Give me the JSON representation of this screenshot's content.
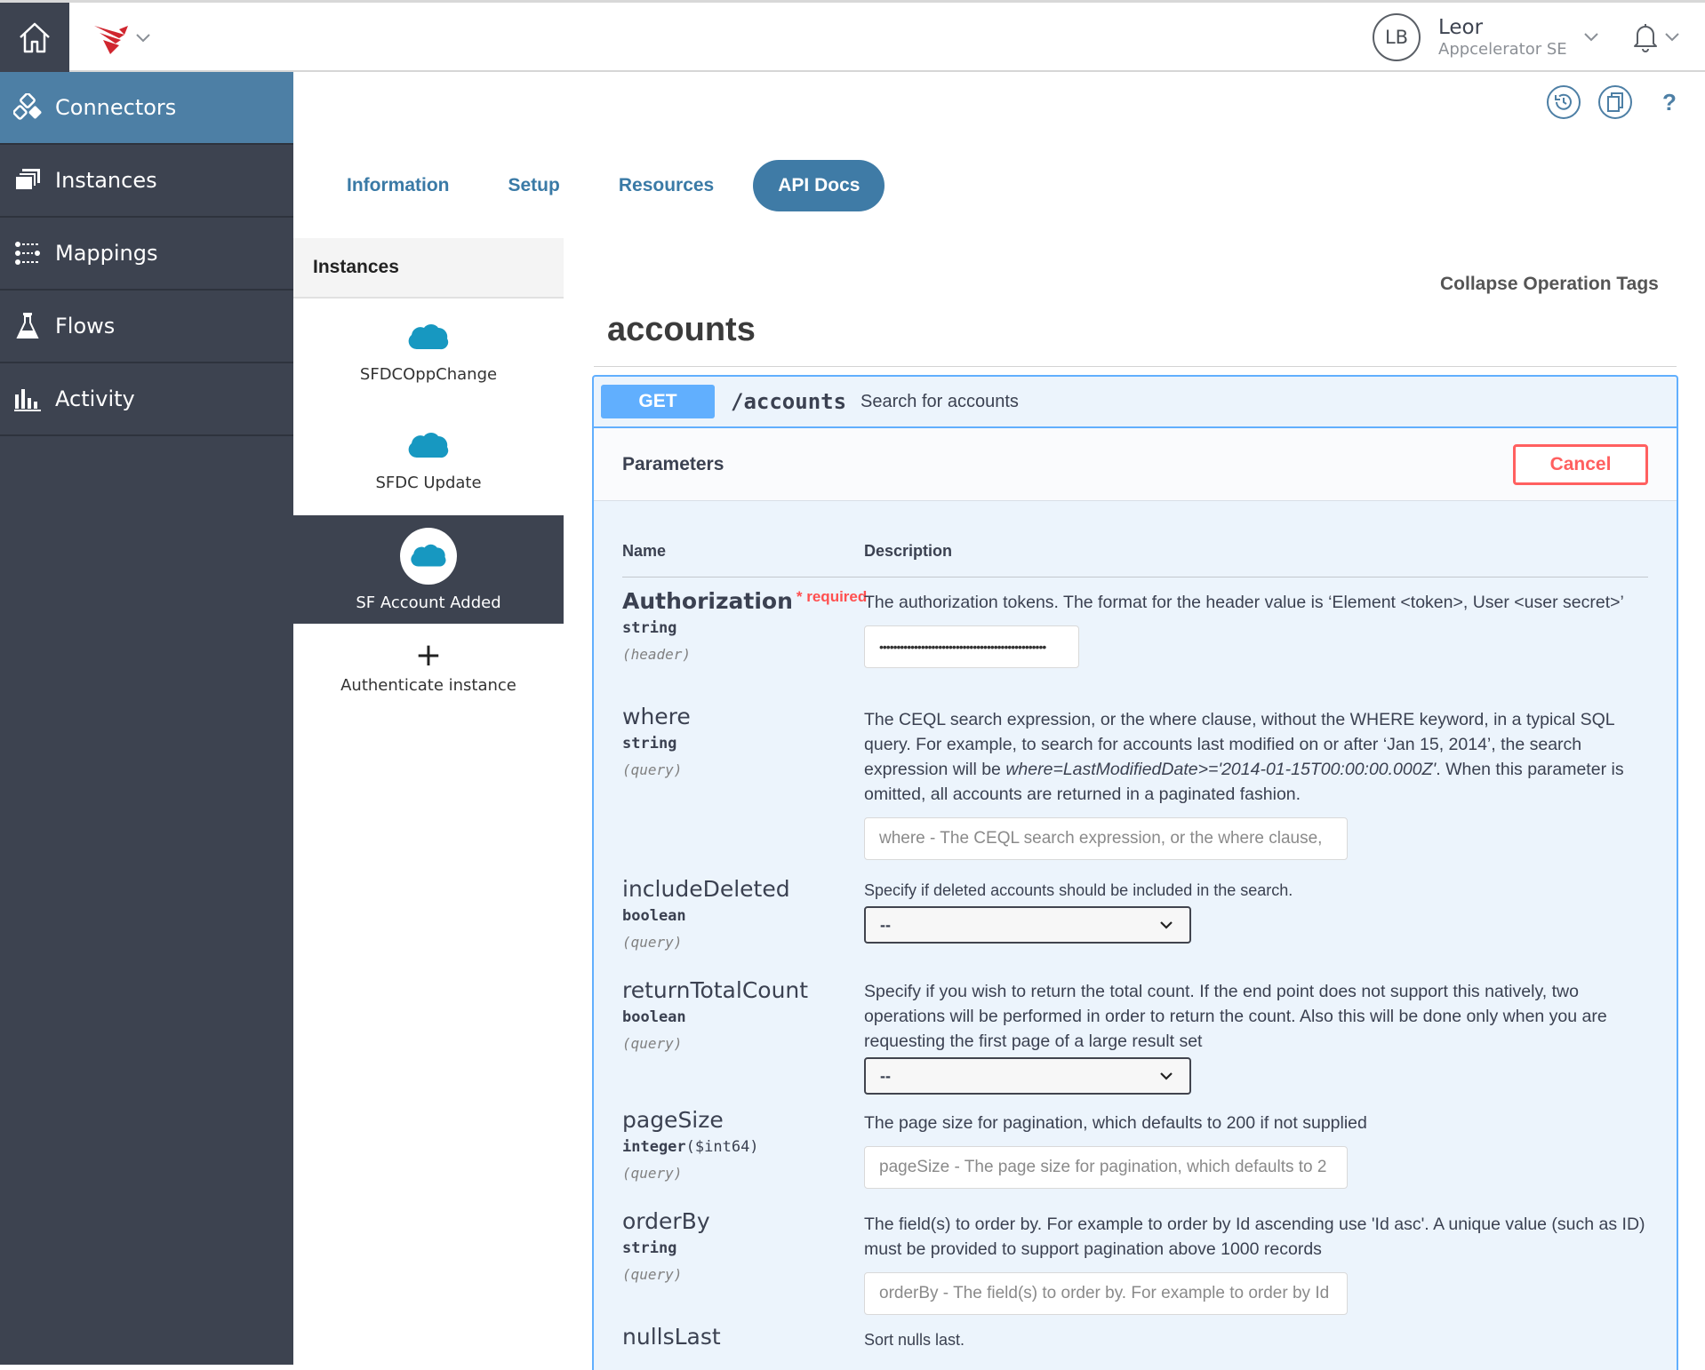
{
  "topbar": {
    "user": {
      "initials": "LB",
      "name": "Leor",
      "role": "Appcelerator SE"
    }
  },
  "sidebar": {
    "items": [
      {
        "label": "Connectors",
        "icon": "connectors-icon",
        "active": true
      },
      {
        "label": "Instances",
        "icon": "instances-icon",
        "active": false
      },
      {
        "label": "Mappings",
        "icon": "mappings-icon",
        "active": false
      },
      {
        "label": "Flows",
        "icon": "flask-icon",
        "active": false
      },
      {
        "label": "Activity",
        "icon": "bar-chart-icon",
        "active": false
      }
    ]
  },
  "tabs": [
    {
      "label": "Information",
      "active": false
    },
    {
      "label": "Setup",
      "active": false
    },
    {
      "label": "Resources",
      "active": false
    },
    {
      "label": "API Docs",
      "active": true
    }
  ],
  "instances_panel": {
    "title": "Instances",
    "items": [
      {
        "label": "SFDCOppChange",
        "active": false
      },
      {
        "label": "SFDC Update",
        "active": false
      },
      {
        "label": "SF Account Added",
        "active": true
      }
    ],
    "add_label": "Authenticate instance",
    "logo_text": "salesforce"
  },
  "docs": {
    "collapse_label": "Collapse Operation Tags",
    "section_title": "accounts",
    "operation": {
      "method": "GET",
      "path": "/accounts",
      "summary": "Search for accounts",
      "parameters_title": "Parameters",
      "cancel_label": "Cancel",
      "col_name": "Name",
      "col_description": "Description",
      "params": [
        {
          "name": "Authorization",
          "required_label": "required",
          "type": "string",
          "in": "(header)",
          "description": "The authorization tokens. The format for the header value is ‘Element <token>, User <user secret>’",
          "value": "••••••••••••••••••••••••••••••••••••••••••••••••"
        },
        {
          "name": "where",
          "type": "string",
          "in": "(query)",
          "description_a": "The CEQL search expression, or the where clause, without the WHERE keyword, in a typical SQL query. For example, to search for accounts last modified on or after ‘Jan 15, 2014’, the search expression will be ",
          "description_em": "where=LastModifiedDate>='2014-01-15T00:00:00.000Z'",
          "description_b": ". When this parameter is omitted, all accounts are returned in a paginated fashion.",
          "placeholder": "where - The CEQL search expression, or the where clause,"
        },
        {
          "name": "includeDeleted",
          "type": "boolean",
          "in": "(query)",
          "description": "Specify if deleted accounts should be included in the search.",
          "selected": "--"
        },
        {
          "name": "returnTotalCount",
          "type": "boolean",
          "in": "(query)",
          "description": "Specify if you wish to return the total count. If the end point does not support this natively, two operations will be performed in order to return the count. Also this will be done only when you are requesting the first page of a large result set",
          "selected": "--"
        },
        {
          "name": "pageSize",
          "type": "integer",
          "format": "($int64)",
          "in": "(query)",
          "description": "The page size for pagination, which defaults to 200 if not supplied",
          "placeholder": "pageSize - The page size for pagination, which defaults to 2"
        },
        {
          "name": "orderBy",
          "type": "string",
          "in": "(query)",
          "description": "The field(s) to order by. For example to order by Id ascending use 'Id asc'. A unique value (such as ID) must be provided to support pagination above 1000 records",
          "placeholder": "orderBy - The field(s) to order by. For example to order by Id"
        },
        {
          "name": "nullsLast",
          "description": "Sort nulls last."
        }
      ]
    }
  },
  "colors": {
    "sidebar_bg": "#3d4350",
    "sidebar_active": "#4d7fa5",
    "tab_active": "#3f7ba6",
    "get_blue": "#61affe",
    "cancel_red": "#ff6060",
    "brand_red": "#d0262f"
  }
}
